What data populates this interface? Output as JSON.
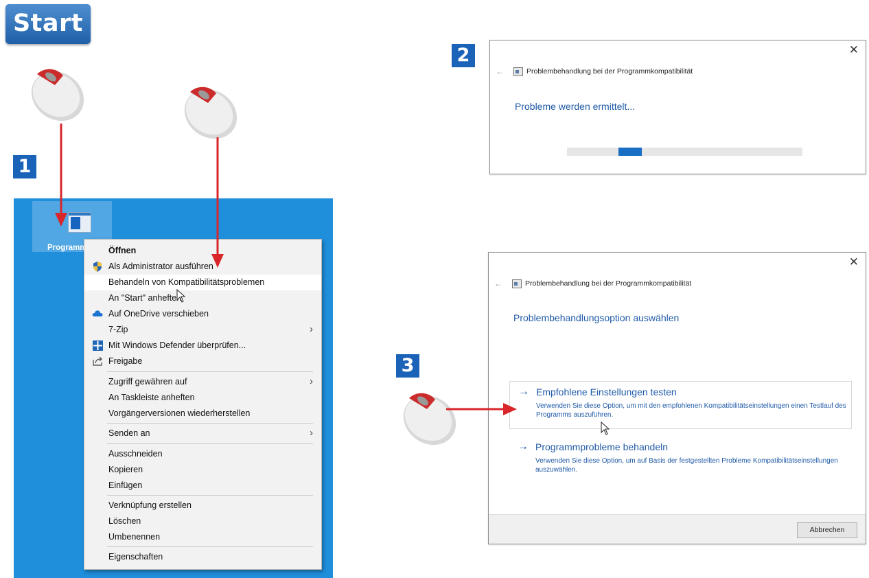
{
  "start_label": "Start",
  "steps": [
    "1",
    "2",
    "3"
  ],
  "desktop": {
    "icon_label": "Programm.exe",
    "context_menu": [
      {
        "label": "Öffnen",
        "icon": "",
        "bold": true
      },
      {
        "label": "Als Administrator ausführen",
        "icon": "uac-shield-icon"
      },
      {
        "label": "Behandeln von Kompatibilitätsproblemen",
        "icon": "",
        "highlighted": true
      },
      {
        "label": "An \"Start\" anheften",
        "icon": ""
      },
      {
        "label": "Auf OneDrive verschieben",
        "icon": "onedrive-cloud-icon"
      },
      {
        "label": "7-Zip",
        "icon": "",
        "submenu": true
      },
      {
        "label": "Mit Windows Defender überprüfen...",
        "icon": "defender-icon"
      },
      {
        "label": "Freigabe",
        "icon": "share-icon"
      },
      {
        "label": "Zugriff gewähren auf",
        "icon": "",
        "submenu": true
      },
      {
        "label": "An Taskleiste anheften",
        "icon": ""
      },
      {
        "label": "Vorgängerversionen wiederherstellen",
        "icon": ""
      },
      {
        "label": "Senden an",
        "icon": "",
        "submenu": true
      },
      {
        "label": "Ausschneiden",
        "icon": ""
      },
      {
        "label": "Kopieren",
        "icon": ""
      },
      {
        "label": "Einfügen",
        "icon": ""
      },
      {
        "label": "Verknüpfung erstellen",
        "icon": ""
      },
      {
        "label": "Löschen",
        "icon": ""
      },
      {
        "label": "Umbenennen",
        "icon": ""
      },
      {
        "label": "Eigenschaften",
        "icon": ""
      }
    ]
  },
  "dialog2": {
    "title": "Problembehandlung bei der Programmkompatibilität",
    "status": "Probleme werden ermittelt...",
    "progress_fraction": 0.1,
    "close_glyph": "✕",
    "back_glyph": "←"
  },
  "dialog3": {
    "title": "Problembehandlung bei der Programmkompatibilität",
    "heading": "Problembehandlungsoption auswählen",
    "options": [
      {
        "title": "Empfohlene Einstellungen testen",
        "description": "Verwenden Sie diese Option, um mit den empfohlenen Kompatibilitätseinstellungen einen Testlauf des Programms auszuführen."
      },
      {
        "title": "Programmprobleme behandeln",
        "description": "Verwenden Sie diese Option, um auf Basis der festgestellten Probleme Kompatibilitätseinstellungen auszuwählen."
      }
    ],
    "cancel_label": "Abbrechen",
    "close_glyph": "✕",
    "back_glyph": "←"
  },
  "colors": {
    "desktop": "#1f8fdc",
    "accent_blue": "#1a63b8",
    "arrow_red": "#d8262b",
    "link_blue": "#1f5aa6"
  }
}
